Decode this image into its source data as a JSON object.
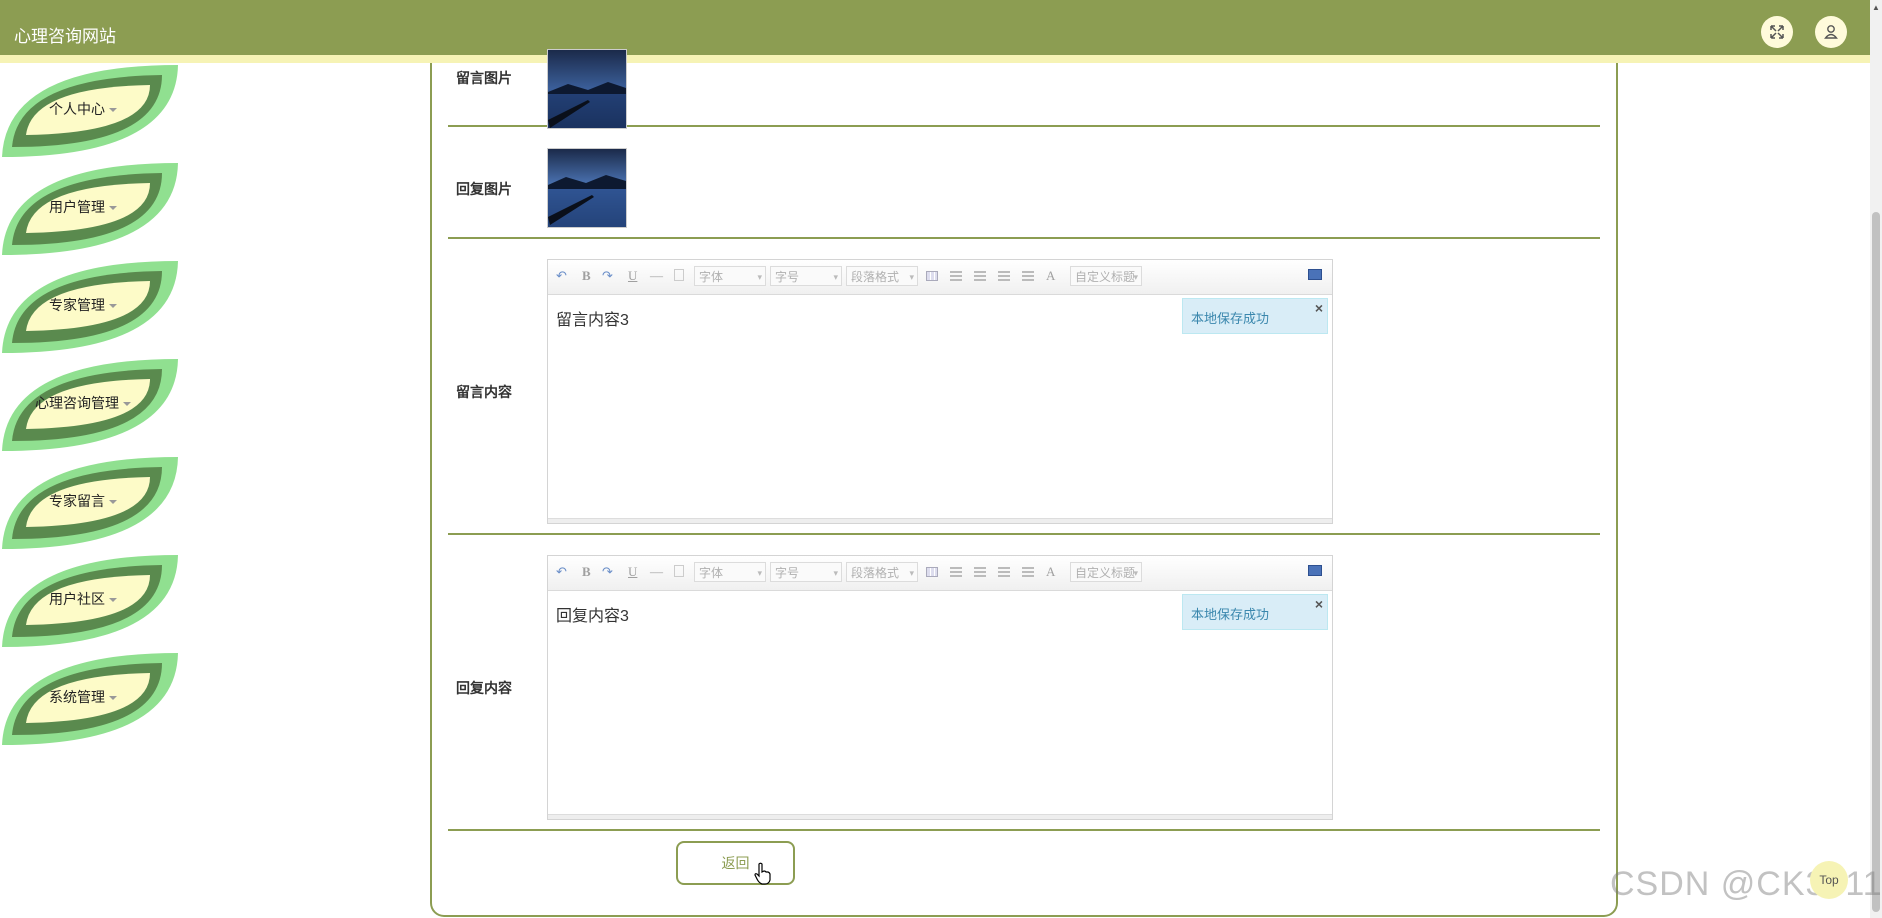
{
  "header": {
    "site_title": "心理咨询网站",
    "fullscreen_icon": "expand-icon",
    "user_icon": "user-icon"
  },
  "sidebar": {
    "items": [
      {
        "label": "个人中心"
      },
      {
        "label": "用户管理"
      },
      {
        "label": "专家管理"
      },
      {
        "label": "心理咨询管理"
      },
      {
        "label": "专家留言"
      },
      {
        "label": "用户社区"
      },
      {
        "label": "系统管理"
      }
    ]
  },
  "form": {
    "message_image_label": "留言图片",
    "reply_image_label": "回复图片",
    "message_content_label": "留言内容",
    "reply_content_label": "回复内容",
    "message_content": "留言内容3",
    "reply_content": "回复内容3",
    "back_label": "返回"
  },
  "editor": {
    "font_placeholder": "字体",
    "size_placeholder": "字号",
    "paragraph_placeholder": "段落格式",
    "custom_title_placeholder": "自定义标题",
    "bold": "B",
    "underline": "U",
    "font_color": "A",
    "save_notice": "本地保存成功",
    "close_symbol": "×"
  },
  "footer": {
    "watermark": "CSDN @CK3011",
    "top_label": "Top"
  },
  "colors": {
    "accent": "#8c9d52",
    "header_strip": "#f6f3b5",
    "leaf_dark": "#5a8a4e",
    "leaf_light": "#90e090",
    "leaf_center": "#fdfbc8",
    "notice_bg": "#d9edf7"
  }
}
